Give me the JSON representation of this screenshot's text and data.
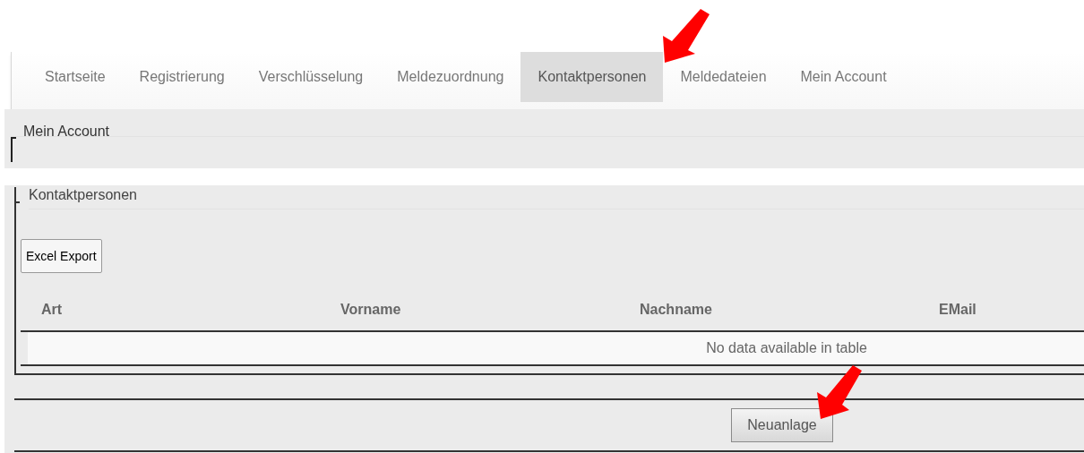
{
  "nav": {
    "tabs": [
      {
        "label": "Startseite",
        "selected": false
      },
      {
        "label": "Registrierung",
        "selected": false
      },
      {
        "label": "Verschlüsselung",
        "selected": false
      },
      {
        "label": "Meldezuordnung",
        "selected": false
      },
      {
        "label": "Kontaktpersonen",
        "selected": true
      },
      {
        "label": "Meldedateien",
        "selected": false
      },
      {
        "label": "Mein Account",
        "selected": false
      }
    ]
  },
  "account_section": {
    "legend": "Mein Account"
  },
  "contacts_section": {
    "legend": "Kontaktpersonen",
    "export_button": "Excel Export",
    "table": {
      "columns": [
        "Art",
        "Vorname",
        "Nachname",
        "EMail"
      ],
      "empty_message": "No data available in table"
    }
  },
  "new_button": "Neuanlage"
}
